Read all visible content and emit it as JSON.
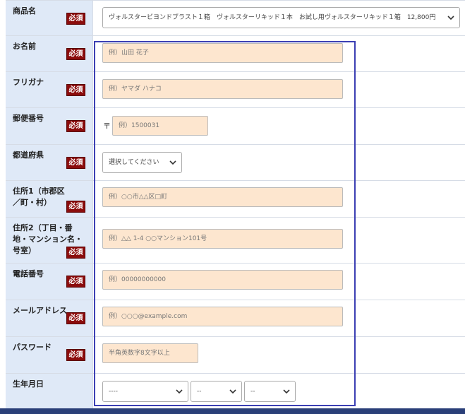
{
  "required_label": "必須",
  "colors": {
    "highlight": "#3b3fb3",
    "label_bg": "#dfe9f7",
    "badge": "#8b0c0c",
    "input_bg": "#fde6cf",
    "footer_bar": "#2a3f78"
  },
  "fields": {
    "product": {
      "label": "商品名",
      "selected": "ヴォルスタービヨンドブラスト１箱　ヴォルスターリキッド１本　お試し用ヴォルスターリキッド１箱　12,800円"
    },
    "name": {
      "label": "お名前",
      "placeholder": "例）山田 花子"
    },
    "furigana": {
      "label": "フリガナ",
      "placeholder": "例）ヤマダ ハナコ"
    },
    "postal": {
      "label": "郵便番号",
      "prefix": "〒",
      "placeholder": "例）1500031"
    },
    "prefecture": {
      "label": "都道府県",
      "selected": "選択してください"
    },
    "address1": {
      "label": "住所1（市郡区／町・村）",
      "placeholder": "例）○○市△△区□町"
    },
    "address2": {
      "label": "住所2（丁目・番地・マンション名・号室）",
      "placeholder": "例）△△ 1-4 ○○マンション101号"
    },
    "phone": {
      "label": "電話番号",
      "placeholder": "例）00000000000"
    },
    "email": {
      "label": "メールアドレス",
      "placeholder": "例）○○○@example.com"
    },
    "password": {
      "label": "パスワード",
      "placeholder": "半角英数字8文字以上"
    },
    "birthdate": {
      "label": "生年月日",
      "year": "----",
      "month": "--",
      "day": "--"
    }
  }
}
